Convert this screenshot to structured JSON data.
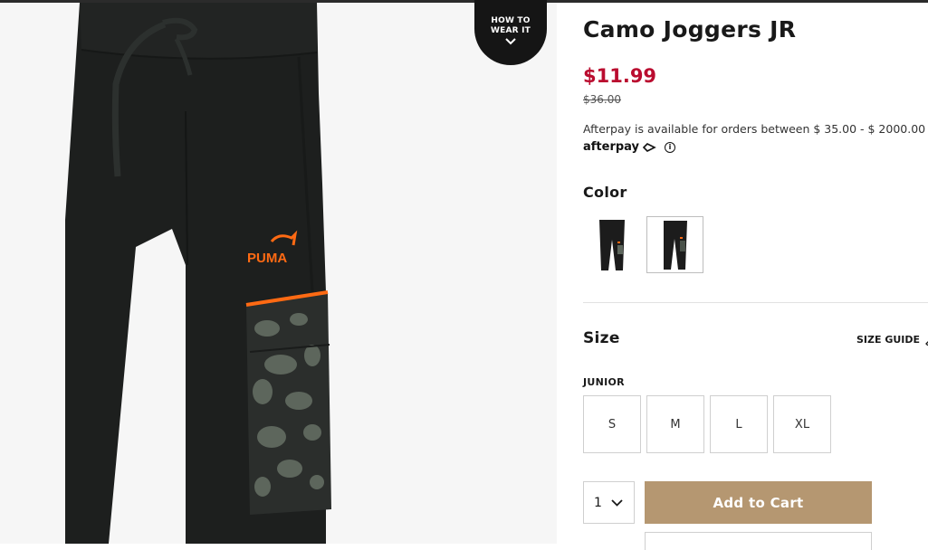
{
  "image": {
    "alt_icon": "product-photo",
    "logo_text": "PUMA",
    "accent_color": "#ff6a13"
  },
  "wear_badge": {
    "line1": "HOW TO",
    "line2": "WEAR IT",
    "icon": "chevron-down-icon"
  },
  "product": {
    "title": "Camo Joggers JR",
    "sale_price": "$11.99",
    "original_price": "$36.00",
    "sale_color": "#ba0c2f"
  },
  "afterpay": {
    "text": "Afterpay is available for orders between $ 35.00 - $ 2000.00",
    "logo": "afterpay",
    "info_icon": "info-icon"
  },
  "color": {
    "label": "Color",
    "swatches": [
      {
        "name": "black-joggers",
        "selected": false
      },
      {
        "name": "black-joggers-alt",
        "selected": true
      }
    ]
  },
  "size": {
    "label": "Size",
    "guide_label": "SIZE GUIDE",
    "guide_icon": "ruler-icon",
    "group_label": "JUNIOR",
    "options": [
      "S",
      "M",
      "L",
      "XL"
    ]
  },
  "cart": {
    "quantity": "1",
    "add_label": "Add to Cart",
    "button_color": "#b59771"
  }
}
